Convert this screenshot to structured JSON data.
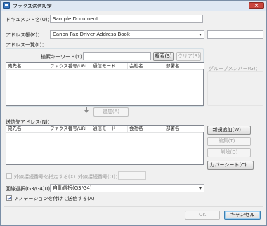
{
  "window": {
    "title": "ファクス送信設定",
    "close_label": "×"
  },
  "document_name": {
    "label": "ドキュメント名(U)：",
    "value": "Sample Document"
  },
  "address_book": {
    "label": "アドレス帳(K)：",
    "selected": "Canon Fax Driver Address Book"
  },
  "address_list": {
    "label": "アドレス一覧(L)：",
    "search_label": "検索キーワード(Y)：",
    "search_value": "",
    "search_button": "検索(S)",
    "clear_button": "クリア(R)",
    "columns": [
      "宛先名",
      "ファクス番号/URI",
      "通信モード",
      "会社名",
      "部署名"
    ]
  },
  "group_members": {
    "label": "グループメンバー(G)："
  },
  "add_button": "追加(A)",
  "destinations": {
    "label": "送信先アドレス(N)：",
    "columns": [
      "宛先名",
      "ファクス番号/URI",
      "通信モード",
      "会社名",
      "部署名"
    ]
  },
  "side_buttons": {
    "new_add": "新規追加(W)...",
    "edit": "編集(T)...",
    "delete": "削除(D)",
    "cover_sheet": "カバーシート(C)..."
  },
  "outside_line": {
    "checkbox_label": "外線接続番号を指定する(X)",
    "number_label": "外線接続番号(O)：",
    "number_value": ""
  },
  "line_select": {
    "label": "回線選択(G3/G4)(I)：",
    "selected": "自動選択(G3/G4)"
  },
  "annotation": {
    "label": "アノテーションを付けて送信する(A)",
    "checked": true
  },
  "footer": {
    "ok": "OK",
    "cancel": "キャンセル"
  }
}
